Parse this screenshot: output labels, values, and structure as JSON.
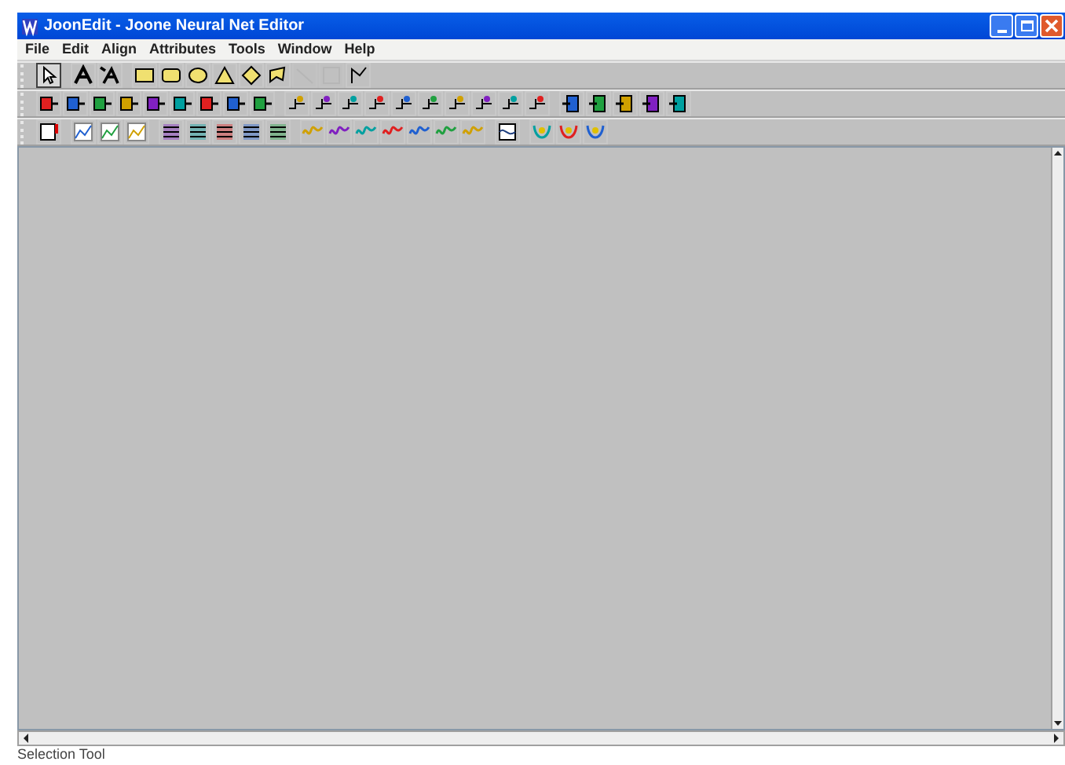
{
  "window": {
    "title": "JoonEdit - Joone Neural Net Editor"
  },
  "menu": [
    {
      "label": "File"
    },
    {
      "label": "Edit"
    },
    {
      "label": "Align"
    },
    {
      "label": "Attributes"
    },
    {
      "label": "Tools"
    },
    {
      "label": "Window"
    },
    {
      "label": "Help"
    }
  ],
  "toolbars": [
    {
      "groups": [
        {
          "buttons": [
            {
              "kind": "select",
              "selected": true,
              "disabled": false
            }
          ]
        },
        {
          "buttons": [
            {
              "kind": "label",
              "selected": false,
              "disabled": false
            },
            {
              "kind": "flex-label",
              "selected": false,
              "disabled": false
            }
          ]
        },
        {
          "buttons": [
            {
              "kind": "rectangle",
              "selected": false,
              "disabled": false
            },
            {
              "kind": "rounded-rectangle",
              "selected": false,
              "disabled": false
            },
            {
              "kind": "ellipse",
              "selected": false,
              "disabled": false
            },
            {
              "kind": "triangle",
              "selected": false,
              "disabled": false
            },
            {
              "kind": "diamond",
              "selected": false,
              "disabled": false
            },
            {
              "kind": "polygon",
              "selected": false,
              "disabled": false
            },
            {
              "kind": "line",
              "selected": false,
              "disabled": true
            },
            {
              "kind": "square",
              "selected": false,
              "disabled": true
            },
            {
              "kind": "polyline",
              "selected": false,
              "disabled": false
            }
          ]
        }
      ]
    },
    {
      "groups": [
        {
          "buttons": [
            {
              "kind": "layer"
            },
            {
              "kind": "layer"
            },
            {
              "kind": "layer"
            },
            {
              "kind": "layer"
            },
            {
              "kind": "layer"
            },
            {
              "kind": "layer"
            },
            {
              "kind": "layer"
            },
            {
              "kind": "layer"
            },
            {
              "kind": "layer"
            }
          ]
        },
        {
          "buttons": [
            {
              "kind": "synapse"
            },
            {
              "kind": "synapse"
            },
            {
              "kind": "synapse"
            },
            {
              "kind": "synapse"
            },
            {
              "kind": "synapse"
            },
            {
              "kind": "synapse"
            },
            {
              "kind": "synapse"
            },
            {
              "kind": "synapse"
            },
            {
              "kind": "synapse"
            },
            {
              "kind": "synapse"
            }
          ]
        },
        {
          "buttons": [
            {
              "kind": "plugin"
            },
            {
              "kind": "plugin"
            },
            {
              "kind": "plugin"
            },
            {
              "kind": "plugin"
            },
            {
              "kind": "plugin"
            }
          ]
        }
      ]
    },
    {
      "groups": [
        {
          "buttons": [
            {
              "kind": "monitor"
            }
          ]
        },
        {
          "buttons": [
            {
              "kind": "chart"
            },
            {
              "kind": "chart"
            },
            {
              "kind": "chart"
            }
          ]
        },
        {
          "buttons": [
            {
              "kind": "matrix"
            },
            {
              "kind": "matrix"
            },
            {
              "kind": "matrix"
            },
            {
              "kind": "matrix"
            },
            {
              "kind": "matrix"
            }
          ]
        },
        {
          "buttons": [
            {
              "kind": "wave"
            },
            {
              "kind": "wave"
            },
            {
              "kind": "wave"
            },
            {
              "kind": "wave"
            },
            {
              "kind": "wave"
            },
            {
              "kind": "wave"
            },
            {
              "kind": "wave"
            }
          ]
        },
        {
          "buttons": [
            {
              "kind": "scope"
            }
          ]
        },
        {
          "buttons": [
            {
              "kind": "curve"
            },
            {
              "kind": "curve"
            },
            {
              "kind": "curve"
            }
          ]
        }
      ]
    }
  ],
  "status_bar": {
    "text": "Selection Tool"
  }
}
